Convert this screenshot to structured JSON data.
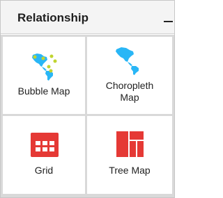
{
  "panel": {
    "title": "Relationship",
    "collapse_icon": "minus-icon"
  },
  "tiles": [
    {
      "label_line1": "Bubble Map",
      "label_line2": "",
      "icon": "bubble-map-icon"
    },
    {
      "label_line1": "Choropleth",
      "label_line2": "Map",
      "icon": "choropleth-map-icon"
    },
    {
      "label_line1": "Grid",
      "label_line2": "",
      "icon": "grid-icon"
    },
    {
      "label_line1": "Tree Map",
      "label_line2": "",
      "icon": "tree-map-icon"
    }
  ],
  "colors": {
    "map_blue": "#29b6f6",
    "bubble_green": "#b8d430",
    "chart_red": "#e53935"
  }
}
